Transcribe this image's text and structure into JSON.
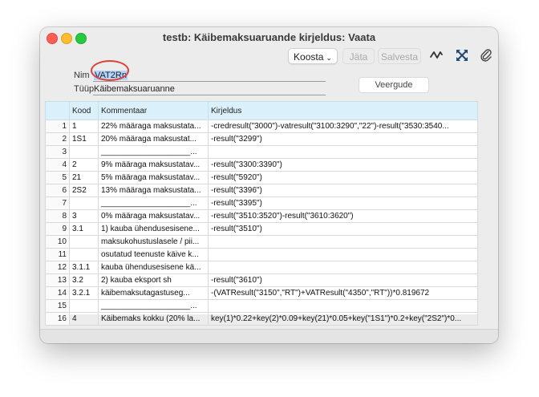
{
  "window": {
    "title": "testb: Käibemaksuaruande kirjeldus: Vaata"
  },
  "toolbar": {
    "koosta_label": "Koosta",
    "koosta_chevron": "⌄",
    "jata_label": "Jäta",
    "salvesta_label": "Salvesta",
    "icons": [
      "activity-icon",
      "expand-icon",
      "paperclip-icon"
    ]
  },
  "form": {
    "nim_label": "Nim",
    "nim_value": "VAT2Rn",
    "tyyp_label": "Tüüp",
    "tyyp_value": "Käibemaksuaruanne",
    "veergude_label": "Veergude"
  },
  "table": {
    "headers": [
      "",
      "Kood",
      "Kommentaar",
      "Kirjeldus"
    ],
    "rows": [
      [
        "1",
        "1",
        "22% määraga maksustata...",
        "-credresult(\"3000\")-vatresult(\"3100:3290\",\"22\")-result(\"3530:3540..."
      ],
      [
        "2",
        "1S1",
        "20% määraga maksustat...",
        "-result(\"3299\")"
      ],
      [
        "3",
        "",
        "____________________...",
        ""
      ],
      [
        "4",
        "2",
        "9% määraga maksustatav...",
        "-result(\"3300:3390\")"
      ],
      [
        "5",
        "21",
        "5% määraga maksustatav...",
        "-result(\"5920\")"
      ],
      [
        "6",
        "2S2",
        "13% määraga maksustata...",
        "-result(\"3396\")"
      ],
      [
        "7",
        "",
        "____________________...",
        "-result(\"3395\")"
      ],
      [
        "8",
        "3",
        "0% määraga maksustatav...",
        "-result(\"3510:3520\")-result(\"3610:3620\")"
      ],
      [
        "9",
        "3.1",
        "1) kauba ühendusesisene...",
        "-result(\"3510\")"
      ],
      [
        "10",
        "",
        "maksukohustuslasele / pii...",
        ""
      ],
      [
        "11",
        "",
        "osutatud teenuste käive k...",
        ""
      ],
      [
        "12",
        "3.1.1",
        "kauba ühendusesisene kä...",
        ""
      ],
      [
        "13",
        "3.2",
        "2) kauba eksport sh",
        "-result(\"3610\")"
      ],
      [
        "14",
        "3.2.1",
        "   käibemaksutagastuseg...",
        "-(VATResult(\"3150\",\"RT\")+VATResult(\"4350\",\"RT\"))*0.819672"
      ],
      [
        "15",
        "",
        "____________________...",
        ""
      ],
      [
        "16",
        "4",
        "Käibemaks kokku (20% la...",
        "key(1)*0.22+key(2)*0.09+key(21)*0.05+key(\"1S1\")*0.2+key(\"2S2\")*0..."
      ]
    ]
  }
}
